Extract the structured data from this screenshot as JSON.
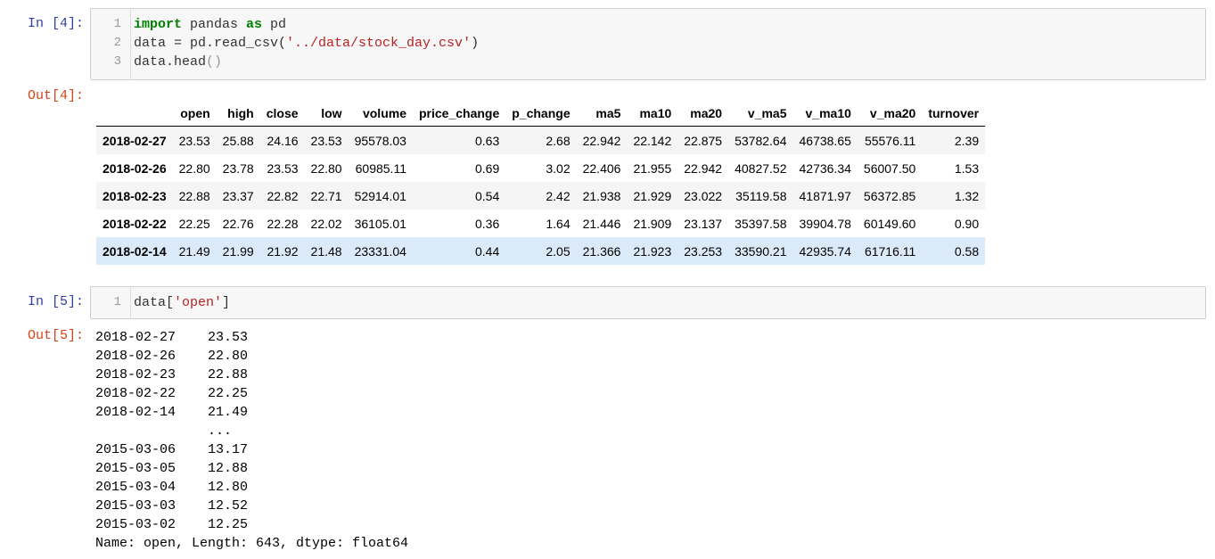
{
  "cell4": {
    "in_prompt": "In  [4]:",
    "out_prompt": "Out[4]:",
    "line_numbers": [
      "1",
      "2",
      "3"
    ],
    "code": {
      "l1_kw1": "import",
      "l1_mid": " pandas ",
      "l1_kw2": "as",
      "l1_end": " pd",
      "l2_pre": "data = pd.read_csv(",
      "l2_str": "'../data/stock_day.csv'",
      "l2_end": ")",
      "l3_pre": "data.head",
      "l3_paren": "()"
    },
    "table": {
      "columns": [
        "open",
        "high",
        "close",
        "low",
        "volume",
        "price_change",
        "p_change",
        "ma5",
        "ma10",
        "ma20",
        "v_ma5",
        "v_ma10",
        "v_ma20",
        "turnover"
      ],
      "rows": [
        {
          "index": "2018-02-27",
          "values": [
            "23.53",
            "25.88",
            "24.16",
            "23.53",
            "95578.03",
            "0.63",
            "2.68",
            "22.942",
            "22.142",
            "22.875",
            "53782.64",
            "46738.65",
            "55576.11",
            "2.39"
          ]
        },
        {
          "index": "2018-02-26",
          "values": [
            "22.80",
            "23.78",
            "23.53",
            "22.80",
            "60985.11",
            "0.69",
            "3.02",
            "22.406",
            "21.955",
            "22.942",
            "40827.52",
            "42736.34",
            "56007.50",
            "1.53"
          ]
        },
        {
          "index": "2018-02-23",
          "values": [
            "22.88",
            "23.37",
            "22.82",
            "22.71",
            "52914.01",
            "0.54",
            "2.42",
            "21.938",
            "21.929",
            "23.022",
            "35119.58",
            "41871.97",
            "56372.85",
            "1.32"
          ]
        },
        {
          "index": "2018-02-22",
          "values": [
            "22.25",
            "22.76",
            "22.28",
            "22.02",
            "36105.01",
            "0.36",
            "1.64",
            "21.446",
            "21.909",
            "23.137",
            "35397.58",
            "39904.78",
            "60149.60",
            "0.90"
          ]
        },
        {
          "index": "2018-02-14",
          "values": [
            "21.49",
            "21.99",
            "21.92",
            "21.48",
            "23331.04",
            "0.44",
            "2.05",
            "21.366",
            "21.923",
            "23.253",
            "33590.21",
            "42935.74",
            "61716.11",
            "0.58"
          ]
        }
      ]
    }
  },
  "cell5": {
    "in_prompt": "In  [5]:",
    "out_prompt": "Out[5]:",
    "line_numbers": [
      "1"
    ],
    "code": {
      "pre": "data[",
      "str": "'open'",
      "end": "]"
    },
    "series": [
      {
        "index": "2018-02-27",
        "value": "23.53"
      },
      {
        "index": "2018-02-26",
        "value": "22.80"
      },
      {
        "index": "2018-02-23",
        "value": "22.88"
      },
      {
        "index": "2018-02-22",
        "value": "22.25"
      },
      {
        "index": "2018-02-14",
        "value": "21.49"
      },
      {
        "index": "",
        "value": "..."
      },
      {
        "index": "2015-03-06",
        "value": "13.17"
      },
      {
        "index": "2015-03-05",
        "value": "12.88"
      },
      {
        "index": "2015-03-04",
        "value": "12.80"
      },
      {
        "index": "2015-03-03",
        "value": "12.52"
      },
      {
        "index": "2015-03-02",
        "value": "12.25"
      }
    ],
    "footer": "Name: open, Length: 643, dtype: float64"
  }
}
